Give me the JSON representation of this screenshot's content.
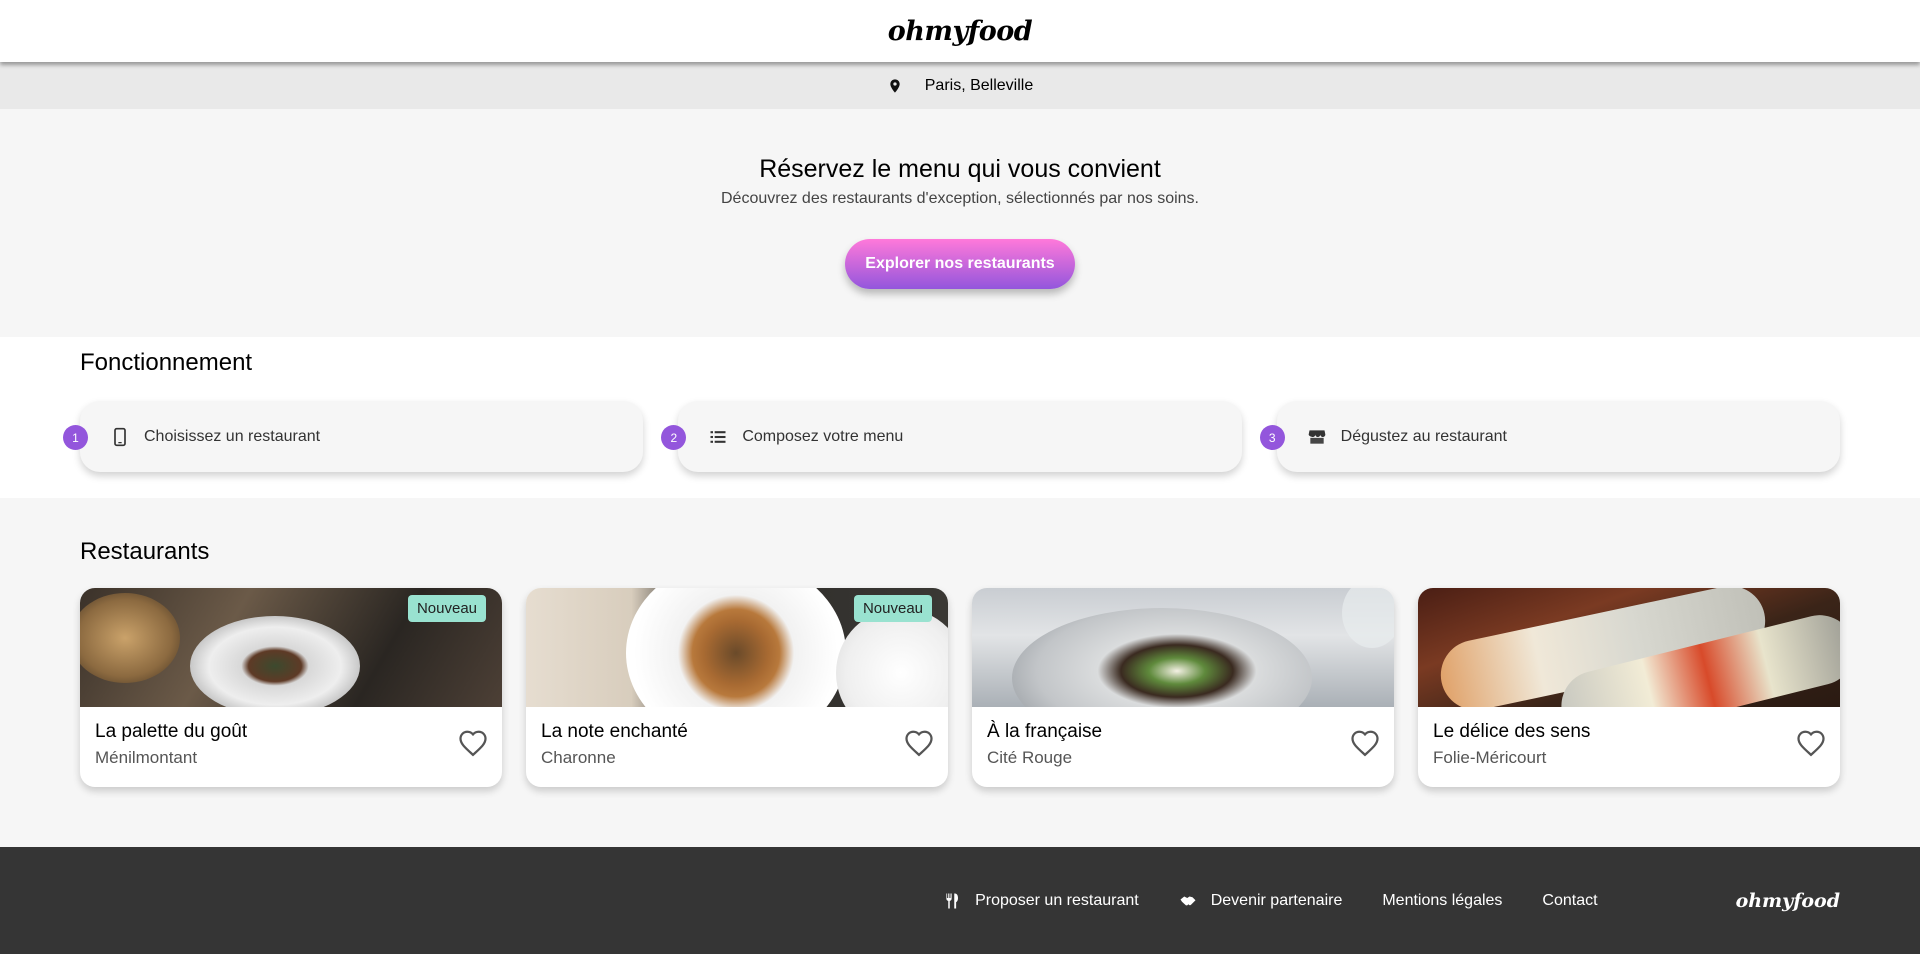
{
  "header": {
    "logo": "ohmyfood"
  },
  "location": {
    "label": "Paris, Belleville",
    "icon": "map-pin-icon"
  },
  "hero": {
    "title": "Réservez le menu qui vous convient",
    "subtitle": "Découvrez des restaurants d'exception, sélectionnés par nos soins.",
    "cta_label": "Explorer nos restaurants"
  },
  "steps": {
    "title": "Fonctionnement",
    "items": [
      {
        "number": "1",
        "icon": "mobile-phone-icon",
        "label": "Choisissez un restaurant"
      },
      {
        "number": "2",
        "icon": "list-icon",
        "label": "Composez votre menu"
      },
      {
        "number": "3",
        "icon": "store-icon",
        "label": "Dégustez au restaurant"
      }
    ]
  },
  "restaurants": {
    "title": "Restaurants",
    "items": [
      {
        "name": "La palette du goût",
        "area": "Ménilmontant",
        "badge": "Nouveau"
      },
      {
        "name": "La note enchanté",
        "area": "Charonne",
        "badge": "Nouveau"
      },
      {
        "name": "À la française",
        "area": "Cité Rouge",
        "badge": ""
      },
      {
        "name": "Le délice des sens",
        "area": "Folie-Méricourt",
        "badge": ""
      }
    ]
  },
  "footer": {
    "links": [
      {
        "label": "Proposer un restaurant",
        "icon": "utensils-icon"
      },
      {
        "label": "Devenir partenaire",
        "icon": "handshake-icon"
      },
      {
        "label": "Mentions légales",
        "icon": ""
      },
      {
        "label": "Contact",
        "icon": ""
      }
    ],
    "logo": "ohmyfood"
  },
  "colors": {
    "accent": "#9356dc",
    "accent_pink": "#ff79da",
    "badge": "#99e2d0",
    "footer_bg": "#353535"
  }
}
